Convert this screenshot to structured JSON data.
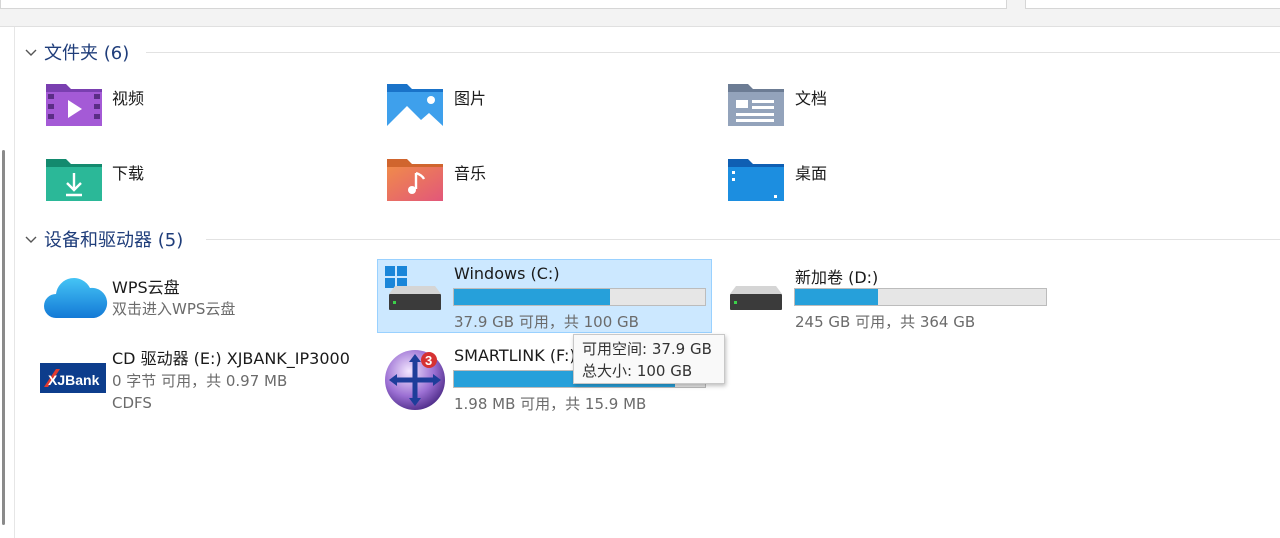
{
  "folders_group": {
    "title": "文件夹 (6)",
    "items": [
      {
        "label": "视频",
        "icon": "videos-folder-icon"
      },
      {
        "label": "图片",
        "icon": "pictures-folder-icon"
      },
      {
        "label": "文档",
        "icon": "documents-folder-icon"
      },
      {
        "label": "下载",
        "icon": "downloads-folder-icon"
      },
      {
        "label": "音乐",
        "icon": "music-folder-icon"
      },
      {
        "label": "桌面",
        "icon": "desktop-folder-icon"
      }
    ]
  },
  "devices_group": {
    "title": "设备和驱动器 (5)",
    "items": [
      {
        "label": "WPS云盘",
        "sub": "双击进入WPS云盘",
        "icon": "wps-cloud-icon"
      },
      {
        "label": "Windows (C:)",
        "sub": "37.9 GB 可用，共 100 GB",
        "used_fraction": 0.62,
        "selected": true,
        "icon": "windows-drive-icon"
      },
      {
        "label": "新加卷 (D:)",
        "sub": "245 GB 可用，共 364 GB",
        "used_fraction": 0.33,
        "icon": "hard-drive-icon"
      },
      {
        "label": "CD 驱动器 (E:) XJBANK_IP3000",
        "sub": "0 字节 可用，共 0.97 MB",
        "sub2": "CDFS",
        "icon": "xjbank-cd-icon"
      },
      {
        "label": "SMARTLINK (F:)",
        "sub": "1.98 MB 可用，共 15.9 MB",
        "used_fraction": 0.88,
        "icon": "smartlink-drive-icon"
      }
    ]
  },
  "tooltip": {
    "line1": "可用空间: 37.9 GB",
    "line2": "总大小: 100 GB"
  },
  "colors": {
    "accent": "#26a0da",
    "selection": "#cce8ff",
    "group_title": "#1f3d7a"
  }
}
